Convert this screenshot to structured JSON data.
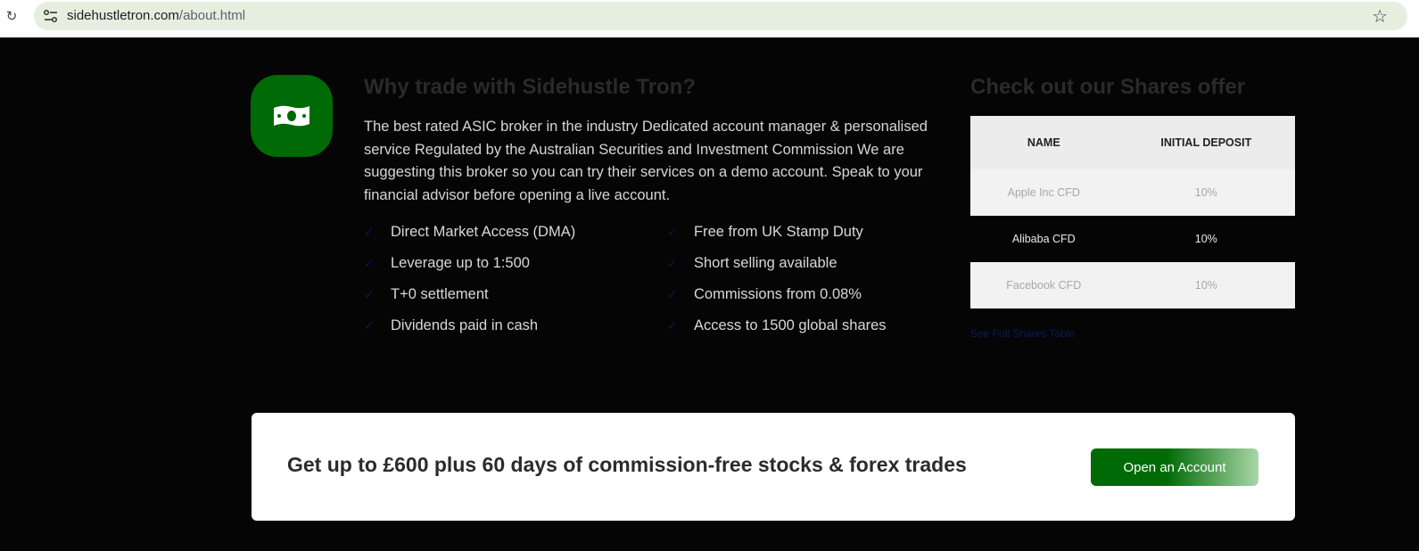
{
  "browser": {
    "url_domain": "sidehustletron.com",
    "url_path": "/about.html",
    "icons": {
      "reload": "reload-icon",
      "site_info": "site-info-icon",
      "bookmark": "star-icon"
    }
  },
  "why": {
    "icon": "money-icon",
    "title": "Why trade with Sidehustle Tron?",
    "description": "The best rated ASIC broker in the industry Dedicated account manager & personalised service Regulated by the Australian Securities and Investment Commission We are suggesting this broker so you can try their services on a demo account. Speak to your financial advisor before opening a live account.",
    "features": [
      "Direct Market Access (DMA)",
      "Free from UK Stamp Duty",
      "Leverage up to 1:500",
      "Short selling available",
      "T+0 settlement",
      "Commissions from 0.08%",
      "Dividends paid in cash",
      "Access to 1500 global shares"
    ]
  },
  "shares": {
    "title": "Check out our Shares offer",
    "headers": [
      "NAME",
      "INITIAL DEPOSIT"
    ],
    "rows": [
      [
        "Apple Inc CFD",
        "10%"
      ],
      [
        "Alibaba CFD",
        "10%"
      ],
      [
        "Facebook CFD",
        "10%"
      ]
    ],
    "link": "See Full Shares Table"
  },
  "promo": {
    "text": "Get up to £600 plus 60 days of commission-free stocks & forex trades",
    "button": "Open an Account"
  },
  "colors": {
    "brand_green": "#006a06",
    "page_bg": "#050505",
    "check": "#0a1a55"
  }
}
